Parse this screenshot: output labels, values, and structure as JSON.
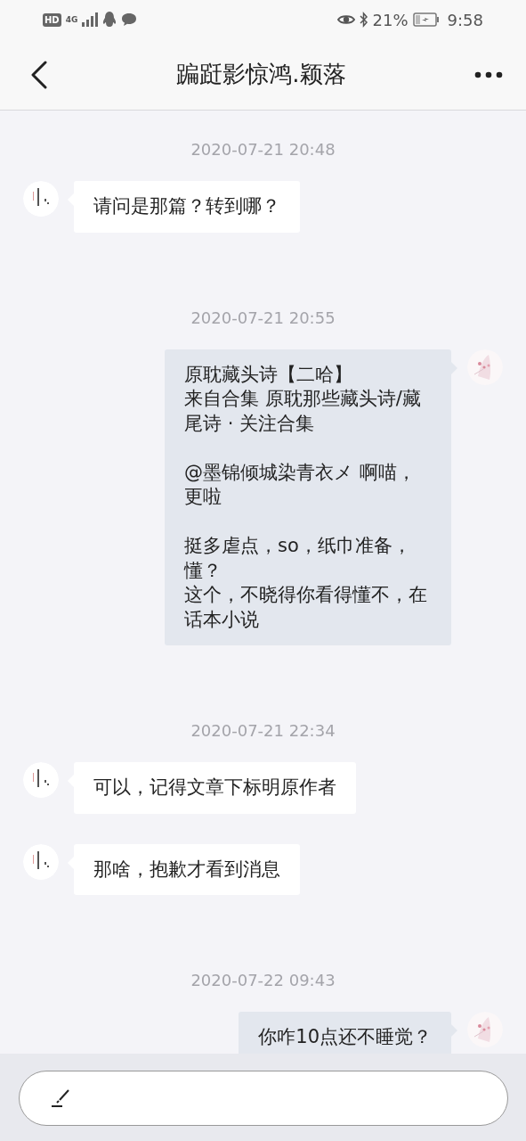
{
  "status_bar": {
    "badge": "HD",
    "network": "4G",
    "battery_percent": "21%",
    "time": "9:58"
  },
  "header": {
    "title": "蹁跹影惊鸿.颖落"
  },
  "messages": [
    {
      "kind": "timestamp",
      "text": "2020-07-21 20:48"
    },
    {
      "kind": "received",
      "blocks": [
        [
          "请问是那篇？转到哪？"
        ]
      ]
    },
    {
      "kind": "timestamp",
      "text": "2020-07-21 20:55"
    },
    {
      "kind": "sent",
      "blocks": [
        [
          "原耽藏头诗【二哈】",
          "来自合集 原耽那些藏头诗/藏尾诗 · 关注合集"
        ],
        [
          "@墨锦倾城染青衣メ 啊喵，更啦"
        ],
        [
          "挺多虐点，so，纸巾准备，懂？",
          "这个，不晓得你看得懂不，在话本小说"
        ]
      ]
    },
    {
      "kind": "timestamp",
      "text": "2020-07-21 22:34"
    },
    {
      "kind": "received",
      "blocks": [
        [
          "可以，记得文章下标明原作者"
        ]
      ]
    },
    {
      "kind": "received",
      "blocks": [
        [
          "那啥，抱歉才看到消息"
        ]
      ]
    },
    {
      "kind": "timestamp",
      "text": "2020-07-22 09:43"
    },
    {
      "kind": "sent",
      "blocks": [
        [
          "你咋10点还不睡觉？"
        ]
      ]
    }
  ]
}
